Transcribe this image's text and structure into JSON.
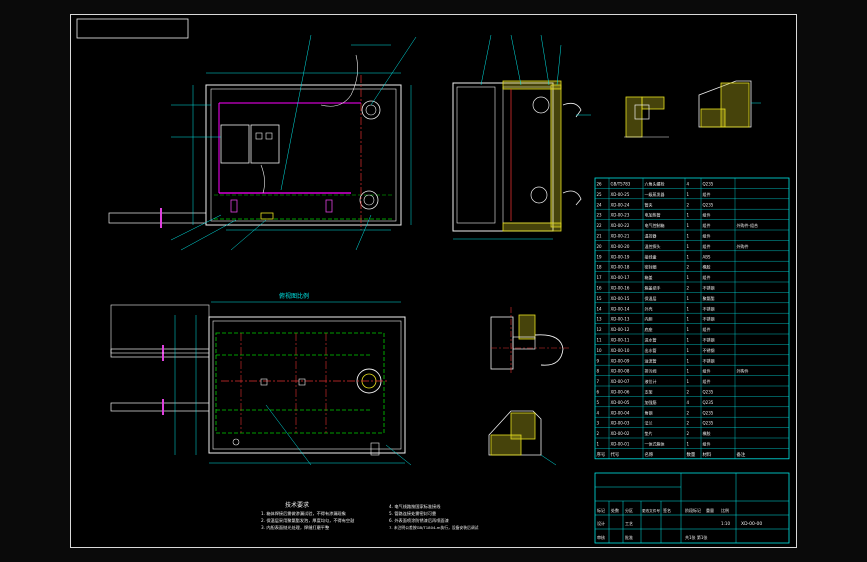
{
  "colors": {
    "background": "#000000",
    "frame": "#ffffff",
    "dimension": "#00e5e5",
    "hidden_line": "#00d000",
    "center_line": "#e03030",
    "wire": "#e040e0",
    "insulation": "#e8e020",
    "outline": "#f0f0f0"
  },
  "drawing": {
    "label_top_view": "俯视图比例"
  },
  "notes": {
    "heading": "技术要求",
    "left_lines": [
      "1. 箱体焊接后需做渗漏试验，不得有渗漏现象",
      "2. 保温层采用聚氨酯发泡，厚度均匀，不得有空鼓",
      "3. 内胆表面抛光处理，焊缝打磨平整"
    ],
    "right_lines": [
      "4. 电气线路按国家标准接线",
      "5. 管路连接处需密封可靠",
      "6. 外表面喷涂防锈漆后再喷面漆",
      "7. 未注明公差按GB/T1804-m执行，设备安装后调试"
    ]
  },
  "parts_table": {
    "rows": [
      [
        "26",
        "GB/T5783",
        "六角头螺栓",
        "4",
        "Q235",
        ""
      ],
      [
        "25",
        "XD-00-25",
        "一级蒸发器",
        "1",
        "组件",
        ""
      ],
      [
        "24",
        "XD-00-24",
        "管夹",
        "2",
        "Q235",
        ""
      ],
      [
        "23",
        "XD-00-23",
        "电加热管",
        "1",
        "组件",
        ""
      ],
      [
        "22",
        "XD-00-22",
        "电气控制箱",
        "1",
        "组件",
        "外购件-组合"
      ],
      [
        "21",
        "XD-00-21",
        "温控器",
        "1",
        "组件",
        ""
      ],
      [
        "20",
        "XD-00-20",
        "温控探头",
        "1",
        "组件",
        "外购件"
      ],
      [
        "19",
        "XD-00-19",
        "接线盒",
        "1",
        "ABS",
        ""
      ],
      [
        "18",
        "XD-00-18",
        "密封圈",
        "2",
        "橡胶",
        ""
      ],
      [
        "17",
        "XD-00-17",
        "箱盖",
        "1",
        "组件",
        ""
      ],
      [
        "16",
        "XD-00-16",
        "箱盖把手",
        "2",
        "不锈钢",
        ""
      ],
      [
        "15",
        "XD-00-15",
        "保温层",
        "1",
        "聚氨酯",
        ""
      ],
      [
        "14",
        "XD-00-14",
        "外壳",
        "1",
        "不锈钢",
        ""
      ],
      [
        "13",
        "XD-00-13",
        "内胆",
        "1",
        "不锈钢",
        ""
      ],
      [
        "12",
        "XD-00-12",
        "底座",
        "1",
        "组件",
        ""
      ],
      [
        "11",
        "XD-00-11",
        "进水管",
        "1",
        "不锈钢",
        ""
      ],
      [
        "10",
        "XD-00-10",
        "出水管",
        "1",
        "不锈钢",
        ""
      ],
      [
        "9",
        "XD-00-09",
        "溢流管",
        "1",
        "不锈钢",
        ""
      ],
      [
        "8",
        "XD-00-08",
        "排污阀",
        "1",
        "组件",
        "外购件"
      ],
      [
        "7",
        "XD-00-07",
        "液位计",
        "1",
        "组件",
        ""
      ],
      [
        "6",
        "XD-00-06",
        "支架",
        "2",
        "Q235",
        ""
      ],
      [
        "5",
        "XD-00-05",
        "加强筋",
        "4",
        "Q235",
        ""
      ],
      [
        "4",
        "XD-00-04",
        "角钢",
        "2",
        "Q235",
        ""
      ],
      [
        "3",
        "XD-00-03",
        "法兰",
        "2",
        "Q235",
        ""
      ],
      [
        "2",
        "XD-00-02",
        "垫片",
        "2",
        "橡胶",
        ""
      ],
      [
        "1",
        "XD-00-01",
        "一体式箱体",
        "1",
        "组件",
        ""
      ]
    ],
    "header": [
      "序号",
      "代号",
      "名称",
      "数量",
      "材料",
      "备注"
    ]
  },
  "title_block": {
    "drawing_no": "XD-00-00",
    "scale": "1:10",
    "sheet": "共1张 第1张",
    "row_labels": [
      "标记",
      "处数",
      "分区",
      "更改文件号",
      "签名",
      "年月日"
    ],
    "roles": [
      "设计",
      "审核",
      "工艺",
      "批准"
    ],
    "fields": [
      "阶段标记",
      "重量",
      "比例"
    ]
  }
}
